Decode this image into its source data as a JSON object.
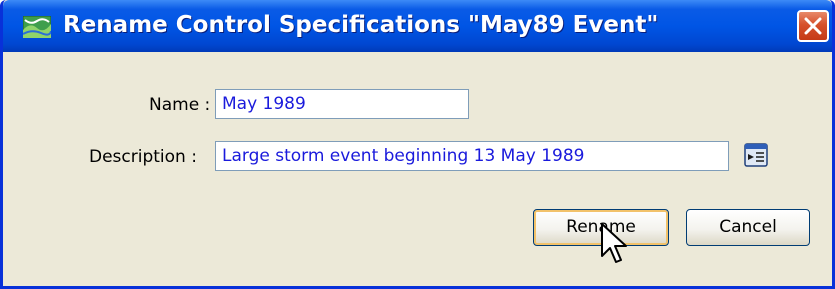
{
  "dialog": {
    "title": "Rename Control Specifications \"May89 Event\""
  },
  "form": {
    "name_label": "Name :",
    "name_value": "May 1989",
    "description_label": "Description :",
    "description_value": "Large storm event beginning 13 May 1989"
  },
  "buttons": {
    "rename": "Rename",
    "cancel": "Cancel"
  },
  "icons": {
    "app": "map-landscape-icon",
    "close": "close-icon",
    "edit_description": "edit-description-icon",
    "cursor": "mouse-pointer-icon"
  },
  "colors": {
    "titlebar": "#0055e5",
    "dialog_bg": "#ece9d8",
    "input_text": "#1a1adc",
    "close_button": "#d6512c"
  }
}
